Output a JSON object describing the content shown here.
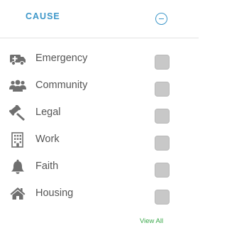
{
  "header": {
    "title": "CAUSE"
  },
  "causes": [
    {
      "label": "Emergency",
      "icon": "ambulance-icon",
      "checked": false
    },
    {
      "label": "Community",
      "icon": "people-icon",
      "checked": false
    },
    {
      "label": "Legal",
      "icon": "gavel-icon",
      "checked": false
    },
    {
      "label": "Work",
      "icon": "office-building-icon",
      "checked": false
    },
    {
      "label": "Faith",
      "icon": "bell-icon",
      "checked": false
    },
    {
      "label": "Housing",
      "icon": "home-icon",
      "checked": false
    }
  ],
  "footer": {
    "view_all_label": "View All"
  },
  "colors": {
    "accent": "#3d97c9",
    "link": "#3aa84a",
    "icon": "#6f6f6f",
    "checkbox": "#c8c8c8"
  }
}
